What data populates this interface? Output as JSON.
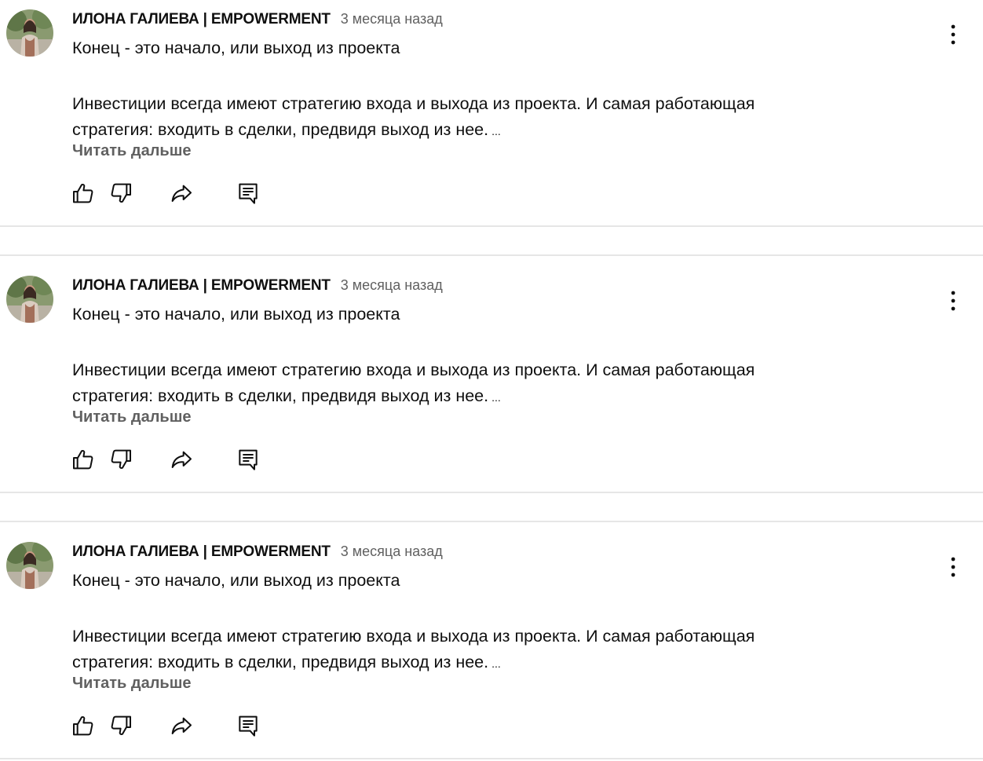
{
  "posts": [
    {
      "author": "ИЛОНА ГАЛИЕВА | EMPOWERMENT",
      "time": "3 месяца назад",
      "title": "Конец - это начало, или выход из проекта",
      "body_line1": "Инвестиции всегда имеют стратегию входа и выхода из проекта.  И самая работающая",
      "body_line2": "стратегия: входить в сделки, предвидя выход из нее.",
      "ellipsis": "...",
      "read_more": "Читать дальше",
      "icons": [
        "thumb-up-icon",
        "thumb-down-icon",
        "share-icon",
        "comment-icon",
        "more-vert-icon"
      ]
    },
    {
      "author": "ИЛОНА ГАЛИЕВА | EMPOWERMENT",
      "time": "3 месяца назад",
      "title": "Конец - это начало, или выход из проекта",
      "body_line1": "Инвестиции всегда имеют стратегию входа и выхода из проекта.  И самая работающая",
      "body_line2": "стратегия: входить в сделки, предвидя выход из нее.",
      "ellipsis": "...",
      "read_more": "Читать дальше",
      "icons": [
        "thumb-up-icon",
        "thumb-down-icon",
        "share-icon",
        "comment-icon",
        "more-vert-icon"
      ]
    },
    {
      "author": "ИЛОНА ГАЛИЕВА | EMPOWERMENT",
      "time": "3 месяца назад",
      "title": "Конец - это начало, или выход из проекта",
      "body_line1": "Инвестиции всегда имеют стратегию входа и выхода из проекта.  И самая работающая",
      "body_line2": "стратегия: входить в сделки, предвидя выход из нее.",
      "ellipsis": "...",
      "read_more": "Читать дальше",
      "icons": [
        "thumb-up-icon",
        "thumb-down-icon",
        "share-icon",
        "comment-icon",
        "more-vert-icon"
      ]
    }
  ],
  "colors": {
    "text_primary": "#0f0f0f",
    "text_secondary": "#606060",
    "divider": "#e6e6e6",
    "background": "#ffffff"
  }
}
